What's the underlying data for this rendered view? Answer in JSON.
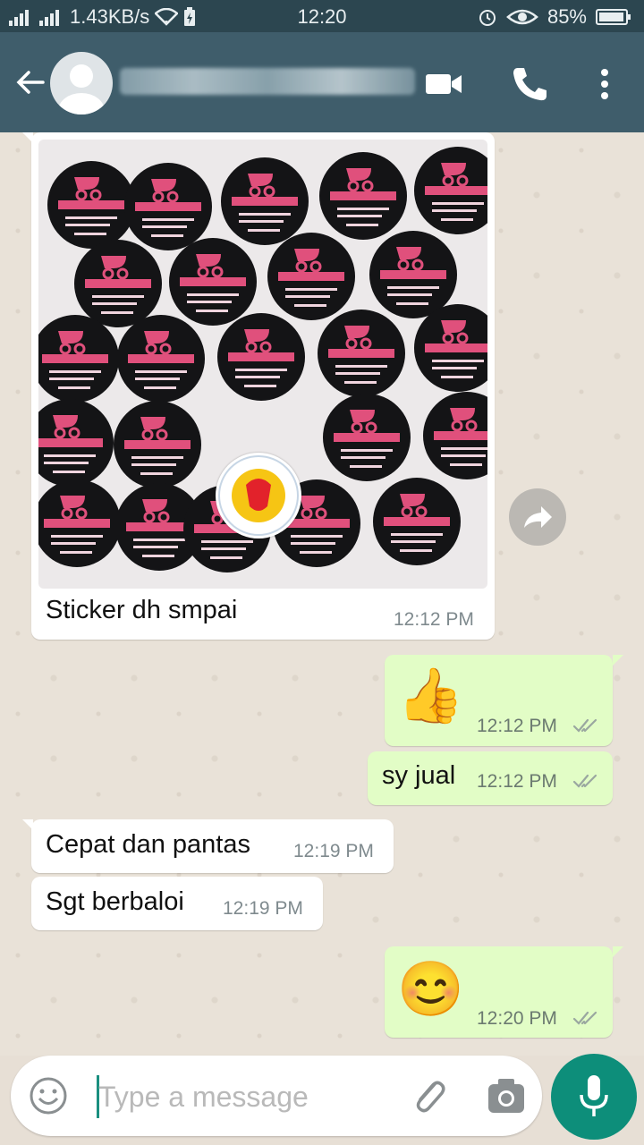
{
  "status_bar": {
    "network_speed": "1.43KB/s",
    "time": "12:20",
    "battery": "85%"
  },
  "header": {
    "icons": [
      "back-arrow-icon",
      "avatar-icon",
      "video-call-icon",
      "phone-icon",
      "more-vert-icon"
    ]
  },
  "messages": [
    {
      "direction": "in",
      "type": "image",
      "caption": "Sticker dh smpai",
      "time": "12:12 PM"
    },
    {
      "direction": "out",
      "type": "emoji",
      "emoji": "👍",
      "time": "12:12 PM",
      "status": "read"
    },
    {
      "direction": "out",
      "type": "text",
      "text": "sy jual",
      "time": "12:12 PM",
      "status": "read"
    },
    {
      "direction": "in",
      "type": "text",
      "text": "Cepat dan pantas",
      "time": "12:19 PM"
    },
    {
      "direction": "in",
      "type": "text",
      "text": "Sgt berbaloi",
      "time": "12:19 PM"
    },
    {
      "direction": "out",
      "type": "emoji",
      "emoji": "😊",
      "time": "12:20 PM",
      "status": "read"
    }
  ],
  "input": {
    "placeholder": "Type a message"
  },
  "colors": {
    "status_bar": "#2c4650",
    "app_bar": "#3f5d6b",
    "outgoing_bubble": "#e2fdc6",
    "incoming_bubble": "#ffffff",
    "mic_button": "#0d8e7a"
  }
}
